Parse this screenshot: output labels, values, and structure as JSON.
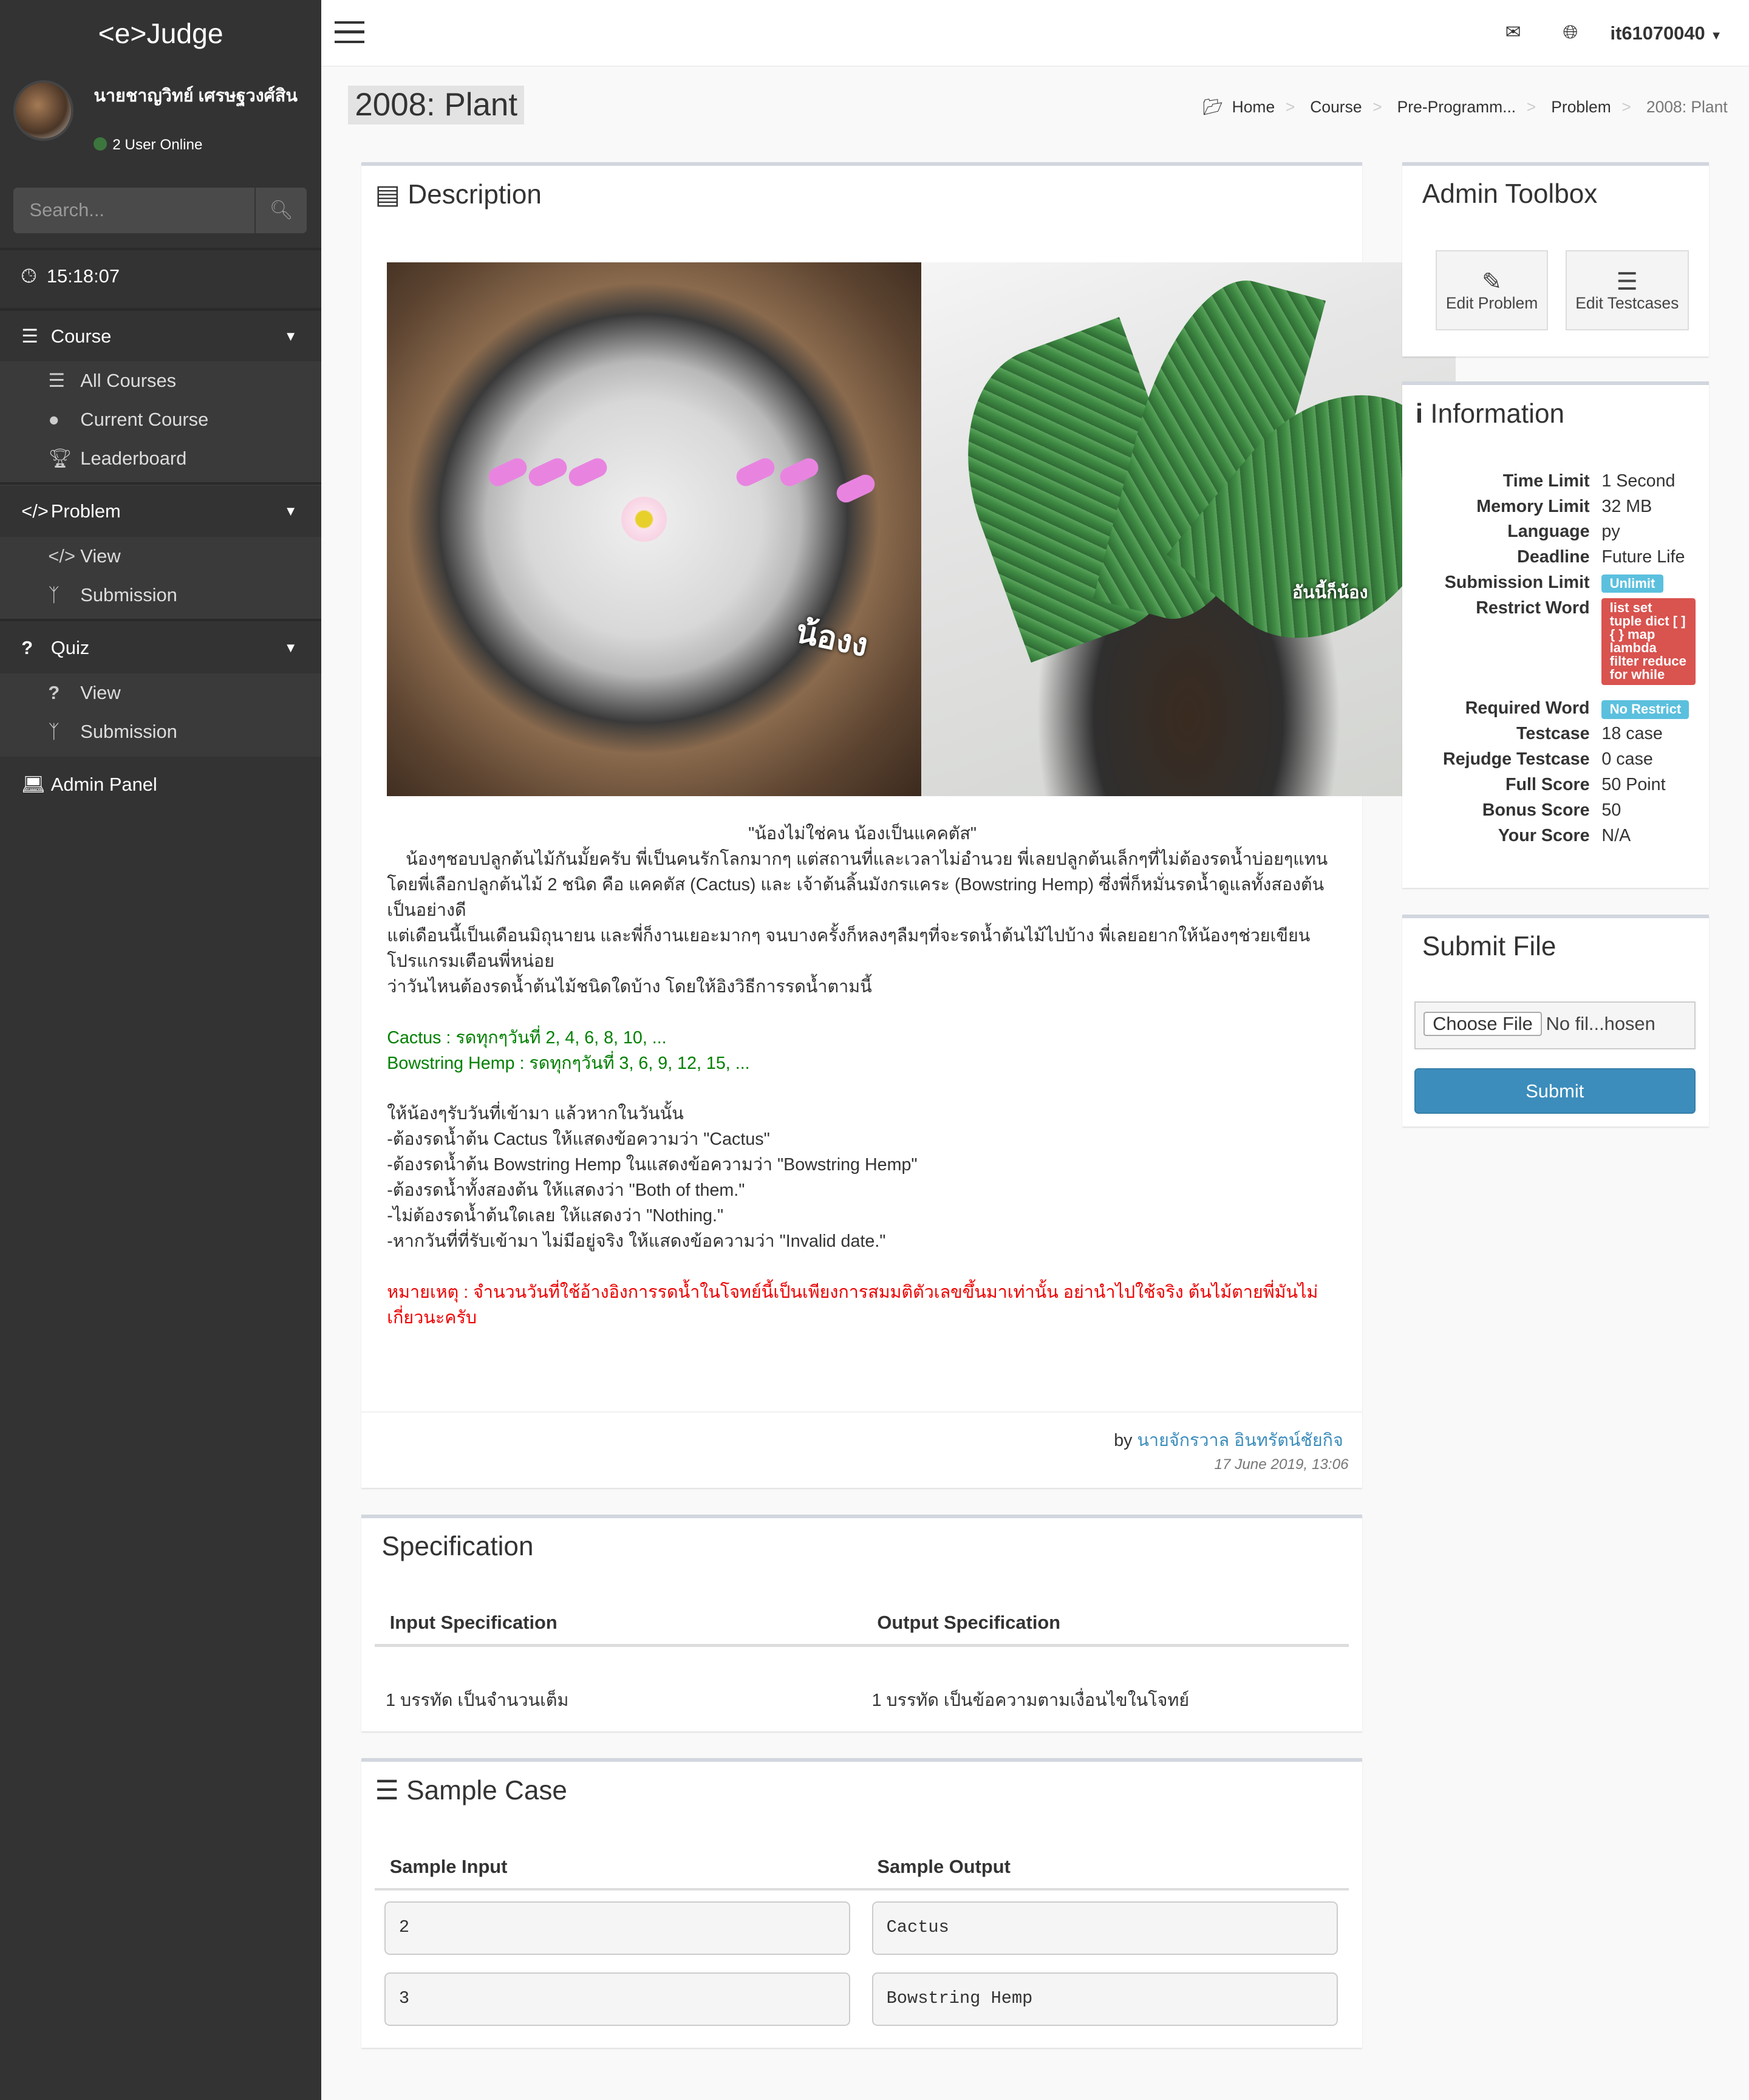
{
  "sidebar": {
    "brand": "<e>Judge",
    "user_name": "นายชาญวิทย์ เศรษฐวงศ์สิน",
    "online": "2 User Online",
    "search_placeholder": "Search...",
    "clock": "15:18:07",
    "course": {
      "label": "Course",
      "items": [
        {
          "label": "All Courses"
        },
        {
          "label": "Current Course"
        },
        {
          "label": "Leaderboard"
        }
      ]
    },
    "problem": {
      "label": "Problem",
      "items": [
        {
          "label": "View"
        },
        {
          "label": "Submission"
        }
      ]
    },
    "quiz": {
      "label": "Quiz",
      "items": [
        {
          "label": "View"
        },
        {
          "label": "Submission"
        }
      ]
    },
    "admin": "Admin Panel"
  },
  "topbar": {
    "username": "it61070040"
  },
  "page_title": "2008: Plant",
  "breadcrumb": [
    "Home",
    "Course",
    "Pre-Programm...",
    "Problem",
    "2008: Plant"
  ],
  "description": {
    "title": "Description",
    "photo_labels": [
      "น้องง",
      "อันนี้ก็น้อง"
    ],
    "quote": "\"น้องไม่ใช่คน น้องเป็นแคคตัส\"",
    "p1": "น้องๆชอบปลูกต้นไม้กันมั้ยครับ พี่เป็นคนรักโลกมากๆ แต่สถานที่และเวลาไม่อำนวย พี่เลยปลูกต้นเล็กๆที่ไม่ต้องรดน้ำบ่อยๆแทน",
    "p2": "โดยพี่เลือกปลูกต้นไม้ 2 ชนิด คือ แคคตัส (Cactus) และ เจ้าต้นลิ้นมังกรแคระ (Bowstring Hemp) ซึ่งพี่ก็หมั่นรดน้ำดูแลทั้งสองต้นเป็นอย่างดี",
    "p3": "แต่เดือนนี้เป็นเดือนมิถุนายน และพี่ก็งานเยอะมากๆ จนบางครั้งก็หลงๆลืมๆที่จะรดน้ำต้นไม้ไปบ้าง พี่เลยอยากให้น้องๆช่วยเขียนโปรแกรมเตือนพี่หน่อย",
    "p4": "ว่าวันไหนต้องรดน้ำต้นไม้ชนิดใดบ้าง โดยให้อิงวิธีการรดน้ำตามนี้",
    "g1": "Cactus : รดทุกๆวันที่ 2, 4, 6, 8, 10, ...",
    "g2": "Bowstring Hemp : รดทุกๆวันที่ 3, 6, 9, 12, 15, ...",
    "r1": "ให้น้องๆรับวันที่เข้ามา แล้วหากในวันนั้น",
    "r2": "-ต้องรดน้ำต้น Cactus ให้แสดงข้อความว่า \"Cactus\"",
    "r3": "-ต้องรดน้ำต้น Bowstring Hemp ในแสดงข้อความว่า \"Bowstring Hemp\"",
    "r4": "-ต้องรดน้ำทั้งสองต้น ให้แสดงว่า \"Both of them.\"",
    "r5": "-ไม่ต้องรดน้ำต้นใดเลย ให้แสดงว่า \"Nothing.\"",
    "r6": "-หากวันที่ที่รับเข้ามา ไม่มีอยู่จริง ให้แสดงข้อความว่า \"Invalid date.\"",
    "note": "หมายเหตุ : จำนวนวันที่ใช้อ้างอิงการรดน้ำในโจทย์นี้เป็นเพียงการสมมติตัวเลขขึ้นมาเท่านั้น อย่านำไปใช้จริง ต้นไม้ตายพี่มันไม่เกี่ยวนะครับ",
    "by": "by",
    "author": "นายจักรวาล อินทรัตน์ชัยกิจ",
    "date": "17 June 2019, 13:06"
  },
  "specification": {
    "title": "Specification",
    "input_header": "Input Specification",
    "output_header": "Output Specification",
    "input": "1 บรรทัด เป็นจำนวนเต็ม",
    "output": "1 บรรทัด เป็นข้อความตามเงื่อนไขในโจทย์"
  },
  "sample": {
    "title": "Sample Case",
    "input_header": "Sample Input",
    "output_header": "Sample Output",
    "cases": [
      {
        "input": "2",
        "output": "Cactus"
      },
      {
        "input": "3",
        "output": "Bowstring Hemp"
      }
    ]
  },
  "toolbox": {
    "title": "Admin Toolbox",
    "edit_problem": "Edit Problem",
    "edit_testcases": "Edit Testcases"
  },
  "information": {
    "title": "Information",
    "rows": [
      {
        "k": "Time Limit",
        "v": "1 Second"
      },
      {
        "k": "Memory Limit",
        "v": "32 MB"
      },
      {
        "k": "Language",
        "v": "py"
      },
      {
        "k": "Deadline",
        "v": "Future Life"
      },
      {
        "k": "Submission Limit",
        "v": "Unlimit"
      },
      {
        "k": "Restrict Word",
        "v": "list set tuple dict [ ] { } map lambda filter reduce for while"
      },
      {
        "k": "Required Word",
        "v": "No Restrict"
      },
      {
        "k": "Testcase",
        "v": "18 case"
      },
      {
        "k": "Rejudge Testcase",
        "v": "0 case"
      },
      {
        "k": "Full Score",
        "v": "50 Point"
      },
      {
        "k": "Bonus Score",
        "v": "50"
      },
      {
        "k": "Your Score",
        "v": "N/A"
      }
    ]
  },
  "submit": {
    "title": "Submit File",
    "choose": "Choose File",
    "no_file": "No fil...hosen",
    "button": "Submit"
  },
  "colors": {
    "sidebar": "#333333",
    "primary": "#3c8dbc",
    "info_label": "#5bc0de",
    "danger_label": "#d9534f"
  }
}
